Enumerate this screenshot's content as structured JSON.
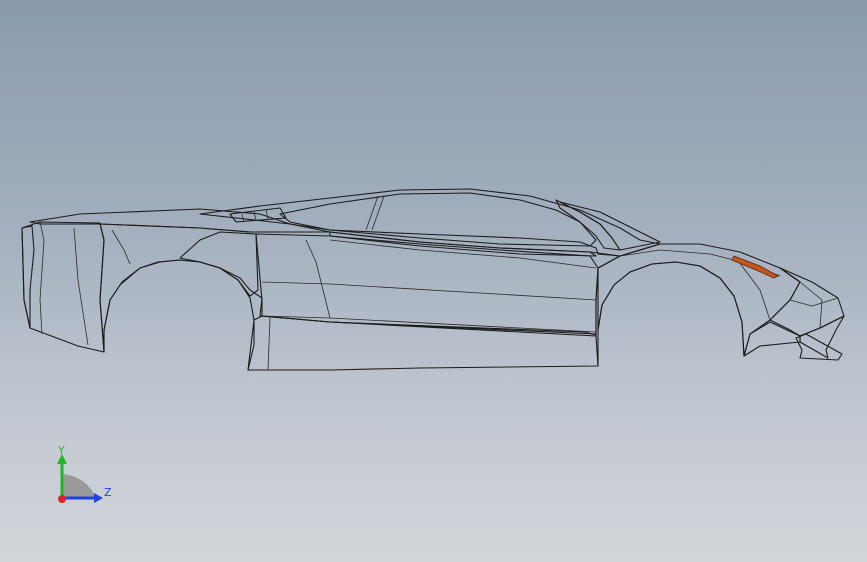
{
  "viewport": {
    "background_top": "#8a9aae",
    "background_bottom": "#d2d5da"
  },
  "model": {
    "body_color": "#ffffff",
    "shade_color": "#c8cbe6",
    "glass_color": "#1e1e1e",
    "accent_color": "#c8551e"
  },
  "triad": {
    "y_label": "Y",
    "z_label": "Z",
    "y_color": "#22b822",
    "z_color": "#2244dd",
    "x_color": "#dd2222"
  }
}
